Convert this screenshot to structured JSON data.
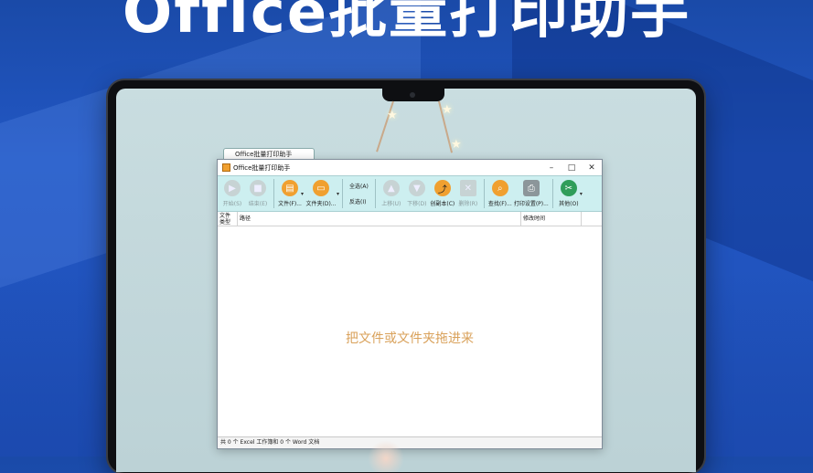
{
  "banner": {
    "title": "Office批量打印助手"
  },
  "window": {
    "tab_label": "Office批量打印助手",
    "title": "Office批量打印助手",
    "controls": {
      "minimize": "–",
      "maximize": "□",
      "close": "✕"
    }
  },
  "toolbar": {
    "start": "开始(S)",
    "stop": "结束(E)",
    "file": "文件(F)...",
    "folder": "文件夹(D)...",
    "select_all": "全选(A)",
    "invert_select": "反选(I)",
    "move_up": "上移(U)",
    "move_down": "下移(D)",
    "create_copy": "创副本(C)",
    "delete": "删除(R)",
    "find": "查找(F)...",
    "print_settings": "打印设置(P)...",
    "other": "其他(O)",
    "dropdown_arrow": "▾"
  },
  "list": {
    "columns": {
      "type": "文件\n类型",
      "path": "路径",
      "modified": "修改时间"
    },
    "empty_hint": "把文件或文件夹拖进来"
  },
  "statusbar": {
    "text": "共 0 个 Excel 工作簿和 0 个 Word 文档"
  },
  "colors": {
    "accent_orange": "#f0a030",
    "toolbar_bg": "#cdeff0",
    "background_blue": "#1f4fb6"
  }
}
